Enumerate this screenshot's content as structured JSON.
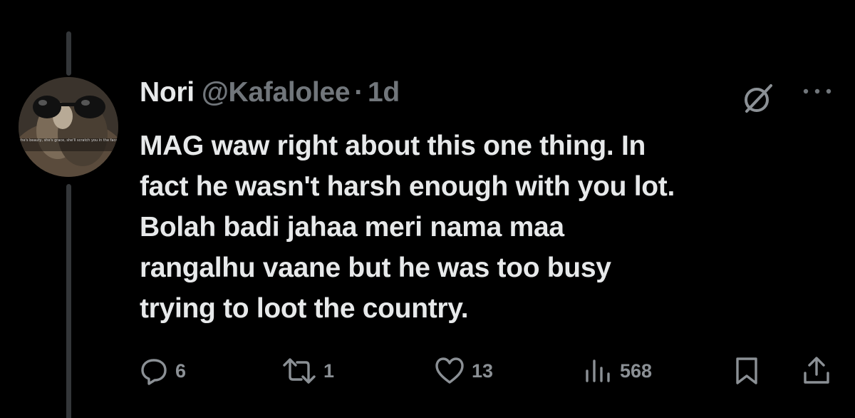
{
  "tweet": {
    "author_name": "Nori",
    "handle": "@Kafalolee",
    "separator": "·",
    "time": "1d",
    "avatar_caption": "she's beauty, she's grace, she'll scratch you in the face",
    "text_lines": [
      "MAG waw right about this one thing. In",
      "fact he wasn't harsh enough with you lot.",
      "Bolah badi jahaa meri nama maa",
      "rangalhu vaane but he was too busy",
      "trying to loot the country."
    ]
  },
  "actions": {
    "replies": "6",
    "reposts": "1",
    "likes": "13",
    "views": "568"
  },
  "icons": {
    "reply": "reply-icon",
    "repost": "repost-icon",
    "like": "heart-icon",
    "views": "views-icon",
    "bookmark": "bookmark-icon",
    "share": "share-icon",
    "grok": "grok-icon",
    "more": "more-icon"
  },
  "colors": {
    "background": "#000000",
    "text": "#e7e9ea",
    "muted": "#71767b",
    "thread_line": "#333639"
  }
}
